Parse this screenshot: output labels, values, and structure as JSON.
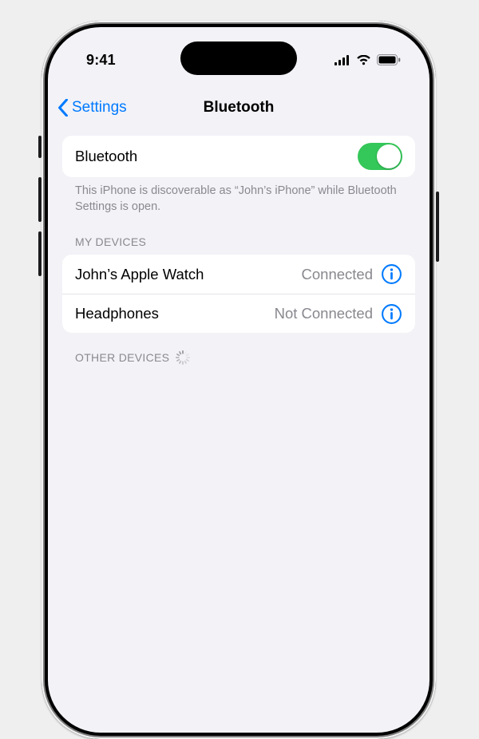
{
  "status": {
    "time": "9:41"
  },
  "nav": {
    "back_label": "Settings",
    "title": "Bluetooth"
  },
  "toggle_row": {
    "label": "Bluetooth",
    "on": true
  },
  "discoverable_note": "This iPhone is discoverable as “John’s iPhone” while Bluetooth Settings is open.",
  "sections": {
    "my_devices": {
      "header": "MY DEVICES",
      "items": [
        {
          "name": "John’s Apple Watch",
          "status": "Connected"
        },
        {
          "name": "Headphones",
          "status": "Not Connected"
        }
      ]
    },
    "other_devices": {
      "header": "OTHER DEVICES"
    }
  },
  "colors": {
    "accent": "#007aff",
    "toggle_on": "#34c759",
    "bg": "#f2f2f7"
  }
}
